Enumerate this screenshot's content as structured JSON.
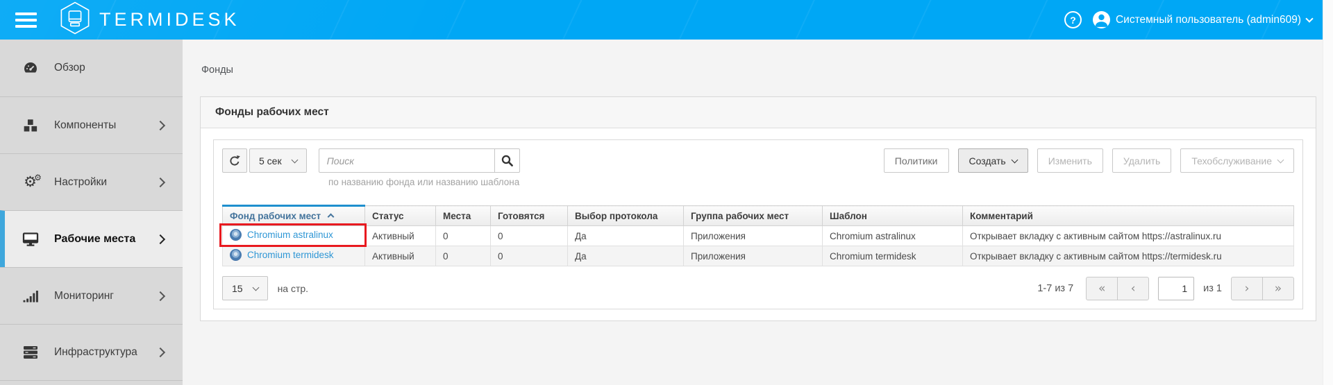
{
  "colors": {
    "header_blue": "#00a7f5",
    "active_item_bar": "#3fa7dc",
    "sorted_column_bar": "#1e8fce",
    "link_blue": "#2e96d5",
    "highlight_red": "#e8191f"
  },
  "header": {
    "logo_text": "TERMIDESK",
    "user_name": "Системный пользователь (admin609)"
  },
  "sidebar": {
    "items": [
      {
        "id": "overview",
        "label": "Обзор",
        "icon": "gauge",
        "active": false,
        "chevron": false
      },
      {
        "id": "components",
        "label": "Компоненты",
        "icon": "cubes",
        "active": false,
        "chevron": true
      },
      {
        "id": "settings",
        "label": "Настройки",
        "icon": "cogs",
        "active": false,
        "chevron": true
      },
      {
        "id": "workplaces",
        "label": "Рабочие места",
        "icon": "desktop",
        "active": true,
        "chevron": true
      },
      {
        "id": "monitoring",
        "label": "Мониторинг",
        "icon": "monitoring",
        "active": false,
        "chevron": true
      },
      {
        "id": "infrastructure",
        "label": "Инфраструктура",
        "icon": "server",
        "active": false,
        "chevron": true
      }
    ]
  },
  "breadcrumb": {
    "label": "Фонды"
  },
  "panel": {
    "title": "Фонды рабочих мест"
  },
  "toolbar": {
    "refresh_interval": "5 сек",
    "search_placeholder": "Поиск",
    "search_hint": "по названию фонда или названию шаблона",
    "actions": [
      {
        "id": "policies",
        "label": "Политики",
        "enabled": true,
        "emphasized": false,
        "dropdown": false
      },
      {
        "id": "create",
        "label": "Создать",
        "enabled": true,
        "emphasized": true,
        "dropdown": true
      },
      {
        "id": "edit",
        "label": "Изменить",
        "enabled": false,
        "emphasized": false,
        "dropdown": false
      },
      {
        "id": "delete",
        "label": "Удалить",
        "enabled": false,
        "emphasized": false,
        "dropdown": false
      },
      {
        "id": "maintenance",
        "label": "Техобслуживание",
        "enabled": false,
        "emphasized": false,
        "dropdown": true
      }
    ]
  },
  "table": {
    "columns": [
      "Фонд рабочих мест",
      "Статус",
      "Места",
      "Готовятся",
      "Выбор протокола",
      "Группа рабочих мест",
      "Шаблон",
      "Комментарий"
    ],
    "sorted_column": 0,
    "sort_direction": "asc",
    "rows": [
      {
        "fond": "Chromium astralinux",
        "status": "Активный",
        "seats": "0",
        "preparing": "0",
        "protocol_choice": "Да",
        "group": "Приложения",
        "template": "Chromium astralinux",
        "comment": "Открывает вкладку с активным сайтом https://astralinux.ru",
        "highlighted": true
      },
      {
        "fond": "Chromium termidesk",
        "status": "Активный",
        "seats": "0",
        "preparing": "0",
        "protocol_choice": "Да",
        "group": "Приложения",
        "template": "Chromium termidesk",
        "comment": "Открывает вкладку с активным сайтом https://termidesk.ru",
        "highlighted": false
      }
    ]
  },
  "footer": {
    "page_size": "15",
    "per_page_label": "на стр.",
    "range_label": "1-7 из 7",
    "page_value": "1",
    "of_label": "из 1",
    "pagination": {
      "first": "«",
      "prev": "‹",
      "next": "›",
      "last": "»"
    }
  }
}
